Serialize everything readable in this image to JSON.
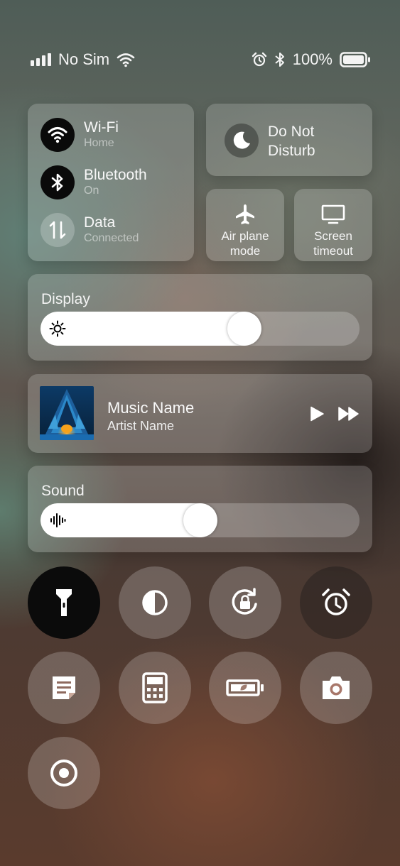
{
  "status_bar": {
    "carrier": "No Sim",
    "battery_percent": "100%",
    "signal_bars": 4,
    "icons": [
      "signal-icon",
      "wifi-icon",
      "alarm-icon",
      "bluetooth-icon",
      "battery-icon"
    ]
  },
  "connectivity": {
    "wifi": {
      "title": "Wi-Fi",
      "subtitle": "Home",
      "active": true,
      "icon": "wifi-icon"
    },
    "bluetooth": {
      "title": "Bluetooth",
      "subtitle": "On",
      "active": true,
      "icon": "bluetooth-icon"
    },
    "data": {
      "title": "Data",
      "subtitle": "Connected",
      "active": false,
      "icon": "data-arrows-icon"
    }
  },
  "do_not_disturb": {
    "label": "Do Not Disturb",
    "icon": "moon-icon"
  },
  "airplane_mode": {
    "label": "Air plane mode",
    "icon": "airplane-icon"
  },
  "screen_timeout": {
    "label": "Screen timeout",
    "icon": "monitor-icon"
  },
  "display": {
    "label": "Display",
    "level": 0.64,
    "icon": "brightness-icon"
  },
  "media": {
    "track": "Music Name",
    "artist": "Artist Name",
    "icons": [
      "album-art",
      "play-icon",
      "next-icon"
    ]
  },
  "sound": {
    "label": "Sound",
    "level": 0.5,
    "icon": "sound-wave-icon"
  },
  "quick_toggles": [
    {
      "name": "flashlight",
      "icon": "flashlight-icon",
      "active": true
    },
    {
      "name": "contrast",
      "icon": "contrast-icon",
      "active": false
    },
    {
      "name": "rotation-lock",
      "icon": "rotation-lock-icon",
      "active": false
    },
    {
      "name": "alarm",
      "icon": "alarm-icon",
      "active": false
    },
    {
      "name": "notes",
      "icon": "notes-icon",
      "active": false
    },
    {
      "name": "calculator",
      "icon": "calculator-icon",
      "active": false
    },
    {
      "name": "battery-saver",
      "icon": "battery-saver-icon",
      "active": false
    },
    {
      "name": "camera",
      "icon": "camera-icon",
      "active": false
    },
    {
      "name": "screen-record",
      "icon": "record-icon",
      "active": false
    }
  ],
  "colors": {
    "active_toggle": "#0b0b0b",
    "slider_fill": "#ffffff"
  }
}
